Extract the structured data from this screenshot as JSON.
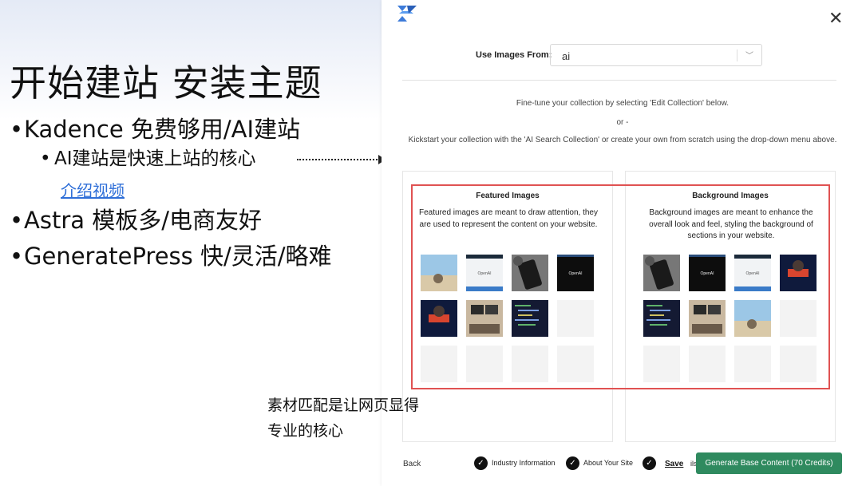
{
  "slide": {
    "title": "开始建站 安装主题",
    "bullets": [
      {
        "text": "Kadence 免费够用/AI建站"
      },
      {
        "text": "AI建站是快速上站的核心"
      },
      {
        "text": "Astra 模板多/电商友好"
      },
      {
        "text": "GeneratePress 快/灵活/略难"
      }
    ],
    "link": "介绍视频",
    "caption_line1": "素材匹配是让网页显得",
    "caption_line2": "专业的核心"
  },
  "modal": {
    "use_images_label": "Use Images From:",
    "use_images_value": "ai",
    "info1": "Fine-tune your collection by selecting 'Edit Collection' below.",
    "info2": "or -",
    "info3": "Kickstart your collection with the 'AI Search Collection' or create your own from scratch using the drop-down menu above.",
    "featured": {
      "title": "Featured Images",
      "desc": "Featured images are meant to draw attention, they are used to represent the content on your website."
    },
    "background": {
      "title": "Background Images",
      "desc": "Background images are meant to enhance the overall look and feel, styling the background of sections in your website."
    },
    "tile_text": "OpenAI",
    "footer": {
      "back": "Back",
      "step1": "Industry Information",
      "step2": "About Your Site",
      "save": "Save",
      "partial": "ils",
      "generate": "Generate Base Content (70 Credits)"
    }
  },
  "colors": {
    "accent_green": "#2f8a5f",
    "highlight_red": "#e05252",
    "logo_blue": "#3d7bd9",
    "link_blue": "#2f6fd8"
  }
}
